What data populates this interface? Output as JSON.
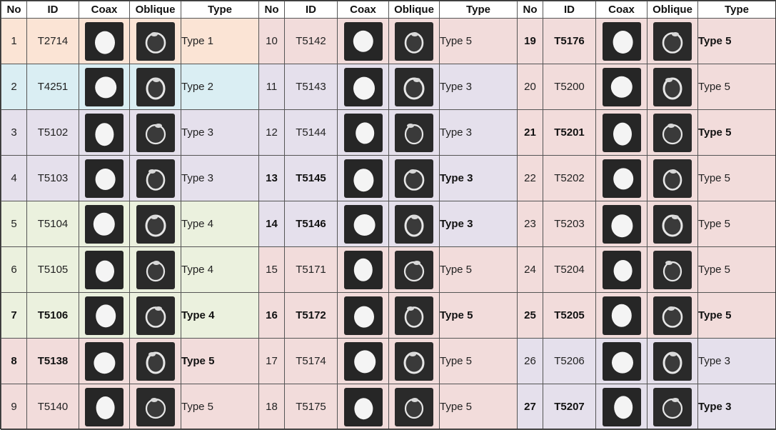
{
  "headers": [
    "No",
    "ID",
    "Coax",
    "Oblique",
    "Type"
  ],
  "colors": {
    "peach": "#fbe4d5",
    "blue": "#daeef3",
    "purple": "#e5e0ec",
    "green": "#ebf1de",
    "pink": "#f2dcdb"
  },
  "columns": [
    {
      "rows": [
        {
          "no": "1",
          "id": "T2714",
          "type": "Type 1",
          "bold": false,
          "color": "peach",
          "coax_icon": "bright-blob-thumbnail",
          "oblique_icon": "ring-thumbnail"
        },
        {
          "no": "2",
          "id": "T4251",
          "type": "Type 2",
          "bold": false,
          "color": "blue",
          "coax_icon": "crescent-blob-thumbnail",
          "oblique_icon": "ring-thumbnail"
        },
        {
          "no": "3",
          "id": "T5102",
          "type": "Type 3",
          "bold": false,
          "color": "purple",
          "coax_icon": "bright-blob-thumbnail",
          "oblique_icon": "ring-thumbnail"
        },
        {
          "no": "4",
          "id": "T5103",
          "type": "Type 3",
          "bold": false,
          "color": "purple",
          "coax_icon": "bright-blob-thumbnail",
          "oblique_icon": "ring-thumbnail"
        },
        {
          "no": "5",
          "id": "T5104",
          "type": "Type 4",
          "bold": false,
          "color": "green",
          "coax_icon": "bright-blob-thumbnail",
          "oblique_icon": "ring-thumbnail"
        },
        {
          "no": "6",
          "id": "T5105",
          "type": "Type 4",
          "bold": false,
          "color": "green",
          "coax_icon": "bright-blob-thumbnail",
          "oblique_icon": "ring-thumbnail"
        },
        {
          "no": "7",
          "id": "T5106",
          "type": "Type 4",
          "bold": true,
          "color": "green",
          "coax_icon": "bright-blob-thumbnail",
          "oblique_icon": "ring-thumbnail"
        },
        {
          "no": "8",
          "id": "T5138",
          "type": "Type 5",
          "bold": true,
          "color": "pink",
          "coax_icon": "bright-blob-thumbnail",
          "oblique_icon": "ring-thumbnail"
        },
        {
          "no": "9",
          "id": "T5140",
          "type": "Type 5",
          "bold": false,
          "color": "pink",
          "coax_icon": "bright-blob-thumbnail",
          "oblique_icon": "ring-thumbnail"
        }
      ]
    },
    {
      "rows": [
        {
          "no": "10",
          "id": "T5142",
          "type": "Type 5",
          "bold": false,
          "color": "pink",
          "coax_icon": "bright-blob-thumbnail",
          "oblique_icon": "ring-thumbnail"
        },
        {
          "no": "11",
          "id": "T5143",
          "type": "Type 3",
          "bold": false,
          "color": "purple",
          "coax_icon": "bright-blob-thumbnail",
          "oblique_icon": "ring-thumbnail"
        },
        {
          "no": "12",
          "id": "T5144",
          "type": "Type 3",
          "bold": false,
          "color": "purple",
          "coax_icon": "bright-blob-thumbnail",
          "oblique_icon": "ring-thumbnail"
        },
        {
          "no": "13",
          "id": "T5145",
          "type": "Type 3",
          "bold": true,
          "color": "purple",
          "coax_icon": "bright-blob-thumbnail",
          "oblique_icon": "ring-thumbnail"
        },
        {
          "no": "14",
          "id": "T5146",
          "type": "Type 3",
          "bold": true,
          "color": "purple",
          "coax_icon": "bright-blob-thumbnail",
          "oblique_icon": "ring-thumbnail"
        },
        {
          "no": "15",
          "id": "T5171",
          "type": "Type 5",
          "bold": false,
          "color": "pink",
          "coax_icon": "bright-blob-thumbnail",
          "oblique_icon": "ring-thumbnail"
        },
        {
          "no": "16",
          "id": "T5172",
          "type": "Type 5",
          "bold": true,
          "color": "pink",
          "coax_icon": "bright-blob-thumbnail",
          "oblique_icon": "ring-thumbnail"
        },
        {
          "no": "17",
          "id": "T5174",
          "type": "Type 5",
          "bold": false,
          "color": "pink",
          "coax_icon": "bright-blob-thumbnail",
          "oblique_icon": "ring-thumbnail"
        },
        {
          "no": "18",
          "id": "T5175",
          "type": "Type 5",
          "bold": false,
          "color": "pink",
          "coax_icon": "bright-blob-thumbnail",
          "oblique_icon": "ring-thumbnail"
        }
      ]
    },
    {
      "rows": [
        {
          "no": "19",
          "id": "T5176",
          "type": "Type 5",
          "bold": true,
          "color": "pink",
          "coax_icon": "bright-blob-thumbnail",
          "oblique_icon": "ring-thumbnail"
        },
        {
          "no": "20",
          "id": "T5200",
          "type": "Type 5",
          "bold": false,
          "color": "pink",
          "coax_icon": "bright-blob-thumbnail",
          "oblique_icon": "ring-thumbnail"
        },
        {
          "no": "21",
          "id": "T5201",
          "type": "Type 5",
          "bold": true,
          "color": "pink",
          "coax_icon": "bright-blob-thumbnail",
          "oblique_icon": "ring-thumbnail"
        },
        {
          "no": "22",
          "id": "T5202",
          "type": "Type 5",
          "bold": false,
          "color": "pink",
          "coax_icon": "bright-blob-thumbnail",
          "oblique_icon": "ring-thumbnail"
        },
        {
          "no": "23",
          "id": "T5203",
          "type": "Type 5",
          "bold": false,
          "color": "pink",
          "coax_icon": "bright-blob-thumbnail",
          "oblique_icon": "ring-thumbnail"
        },
        {
          "no": "24",
          "id": "T5204",
          "type": "Type 5",
          "bold": false,
          "color": "pink",
          "coax_icon": "bright-blob-thumbnail",
          "oblique_icon": "ring-thumbnail"
        },
        {
          "no": "25",
          "id": "T5205",
          "type": "Type 5",
          "bold": true,
          "color": "pink",
          "coax_icon": "bright-blob-thumbnail",
          "oblique_icon": "ring-thumbnail"
        },
        {
          "no": "26",
          "id": "T5206",
          "type": "Type 3",
          "bold": false,
          "color": "purple",
          "coax_icon": "bright-blob-thumbnail",
          "oblique_icon": "ring-thumbnail"
        },
        {
          "no": "27",
          "id": "T5207",
          "type": "Type 3",
          "bold": true,
          "color": "purple",
          "coax_icon": "bright-blob-thumbnail",
          "oblique_icon": "ring-thumbnail"
        }
      ]
    }
  ]
}
